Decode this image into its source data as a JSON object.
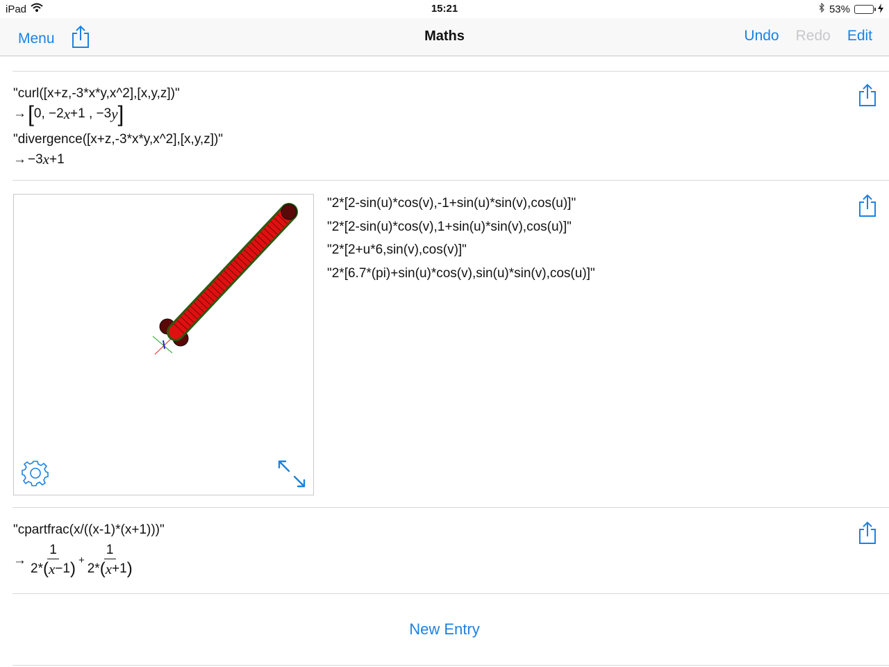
{
  "status_bar": {
    "device": "iPad",
    "time": "15:21",
    "battery_percent": "53%",
    "battery_level": 0.53,
    "icons": [
      "wifi-icon",
      "bluetooth-icon",
      "battery-icon",
      "charging-icon"
    ]
  },
  "nav": {
    "menu_label": "Menu",
    "title": "Maths",
    "undo_label": "Undo",
    "redo_label": "Redo",
    "edit_label": "Edit",
    "accent_color": "#1a82e2",
    "disabled_color": "#c7c7cc"
  },
  "entries": {
    "curl": {
      "input": "\"curl([x+z,-3*x*y,x^2],[x,y,z])\"",
      "arrow": "→",
      "result_open": "[",
      "result_p1": "0, −2",
      "result_var1": "x",
      "result_p2": "+1 , −3",
      "result_var2": "y",
      "result_close": "]"
    },
    "divergence": {
      "input": "\"divergence([x+z,-3*x*y,x^2],[x,y,z])\"",
      "arrow": "→",
      "result_p1": "−3",
      "result_var": "x",
      "result_p2": "+1"
    },
    "plot": {
      "params": [
        "\"2*[2-sin(u)*cos(v),-1+sin(u)*sin(v),cos(u)]\"",
        "\"2*[2-sin(u)*cos(v),1+sin(u)*sin(v),cos(u)]\"",
        "\"2*[2+u*6,sin(v),cos(v)]\"",
        "\"2*[6.7*(pi)+sin(u)*cos(v),sin(u)*sin(v),cos(u)]\""
      ],
      "tube_color": "#e01010",
      "mesh_color": "#2a5a10",
      "sphere_color": "#5a0808"
    },
    "cpartfrac": {
      "input": "\"cpartfrac(x/((x-1)*(x+1)))\"",
      "arrow": "→",
      "frac1_num": "1",
      "frac1_den_pre": "2*",
      "frac1_den_var": "x",
      "frac1_den_post": "−1",
      "plus": "+",
      "frac2_num": "1",
      "frac2_den_pre": "2*",
      "frac2_den_var": "x",
      "frac2_den_post": "+1"
    }
  },
  "new_entry_label": "New Entry"
}
